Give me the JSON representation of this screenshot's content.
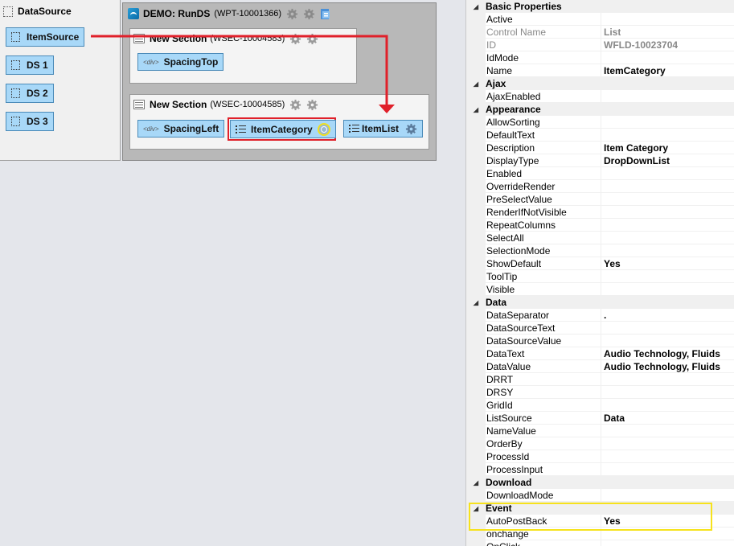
{
  "datasource": {
    "title": "DataSource",
    "items": [
      "ItemSource",
      "DS 1",
      "DS 2",
      "DS 3"
    ]
  },
  "canvas": {
    "page_title": "DEMO: RunDS",
    "page_id": "(WPT-10001366)",
    "sections": [
      {
        "title": "New Section",
        "id": "(WSEC-10004583)",
        "controls": [
          {
            "label": "SpacingTop",
            "type": "div"
          }
        ]
      },
      {
        "title": "New Section",
        "id": "(WSEC-10004585)",
        "controls": [
          {
            "label": "SpacingLeft",
            "type": "div"
          },
          {
            "label": "ItemCategory",
            "type": "list",
            "selected": true
          },
          {
            "label": "ItemList",
            "type": "list"
          }
        ]
      }
    ],
    "div_tag": "div"
  },
  "colors": {
    "control_bg": "#a8d8f8",
    "control_border": "#4a8ab8",
    "arrow": "#e0202a",
    "selection": "#e0202a",
    "highlight": "#f6e21c"
  },
  "properties": [
    {
      "kind": "cat",
      "name": "Basic Properties"
    },
    {
      "kind": "prop",
      "name": "Active",
      "value": ""
    },
    {
      "kind": "prop",
      "name": "Control Name",
      "value": "List",
      "dim": true
    },
    {
      "kind": "prop",
      "name": "ID",
      "value": "WFLD-10023704",
      "dim": true
    },
    {
      "kind": "prop",
      "name": "IdMode",
      "value": ""
    },
    {
      "kind": "prop",
      "name": "Name",
      "value": "ItemCategory"
    },
    {
      "kind": "cat",
      "name": "Ajax"
    },
    {
      "kind": "prop",
      "name": "AjaxEnabled",
      "value": ""
    },
    {
      "kind": "cat",
      "name": "Appearance"
    },
    {
      "kind": "prop",
      "name": "AllowSorting",
      "value": ""
    },
    {
      "kind": "prop",
      "name": "DefaultText",
      "value": ""
    },
    {
      "kind": "prop",
      "name": "Description",
      "value": "Item Category"
    },
    {
      "kind": "prop",
      "name": "DisplayType",
      "value": "DropDownList"
    },
    {
      "kind": "prop",
      "name": "Enabled",
      "value": ""
    },
    {
      "kind": "prop",
      "name": "OverrideRender",
      "value": ""
    },
    {
      "kind": "prop",
      "name": "PreSelectValue",
      "value": ""
    },
    {
      "kind": "prop",
      "name": "RenderIfNotVisible",
      "value": ""
    },
    {
      "kind": "prop",
      "name": "RepeatColumns",
      "value": ""
    },
    {
      "kind": "prop",
      "name": "SelectAll",
      "value": ""
    },
    {
      "kind": "prop",
      "name": "SelectionMode",
      "value": ""
    },
    {
      "kind": "prop",
      "name": "ShowDefault",
      "value": "Yes"
    },
    {
      "kind": "prop",
      "name": "ToolTip",
      "value": ""
    },
    {
      "kind": "prop",
      "name": "Visible",
      "value": ""
    },
    {
      "kind": "cat",
      "name": "Data"
    },
    {
      "kind": "prop",
      "name": "DataSeparator",
      "value": "."
    },
    {
      "kind": "prop",
      "name": "DataSourceText",
      "value": ""
    },
    {
      "kind": "prop",
      "name": "DataSourceValue",
      "value": ""
    },
    {
      "kind": "prop",
      "name": "DataText",
      "value": "Audio Technology, Fluids"
    },
    {
      "kind": "prop",
      "name": "DataValue",
      "value": "Audio Technology, Fluids"
    },
    {
      "kind": "prop",
      "name": "DRRT",
      "value": ""
    },
    {
      "kind": "prop",
      "name": "DRSY",
      "value": ""
    },
    {
      "kind": "prop",
      "name": "GridId",
      "value": ""
    },
    {
      "kind": "prop",
      "name": "ListSource",
      "value": "Data"
    },
    {
      "kind": "prop",
      "name": "NameValue",
      "value": ""
    },
    {
      "kind": "prop",
      "name": "OrderBy",
      "value": ""
    },
    {
      "kind": "prop",
      "name": "ProcessId",
      "value": ""
    },
    {
      "kind": "prop",
      "name": "ProcessInput",
      "value": ""
    },
    {
      "kind": "cat",
      "name": "Download"
    },
    {
      "kind": "prop",
      "name": "DownloadMode",
      "value": ""
    },
    {
      "kind": "cat",
      "name": "Event"
    },
    {
      "kind": "prop",
      "name": "AutoPostBack",
      "value": "Yes"
    },
    {
      "kind": "prop",
      "name": "onchange",
      "value": ""
    },
    {
      "kind": "prop",
      "name": "OnClick",
      "value": ""
    }
  ]
}
